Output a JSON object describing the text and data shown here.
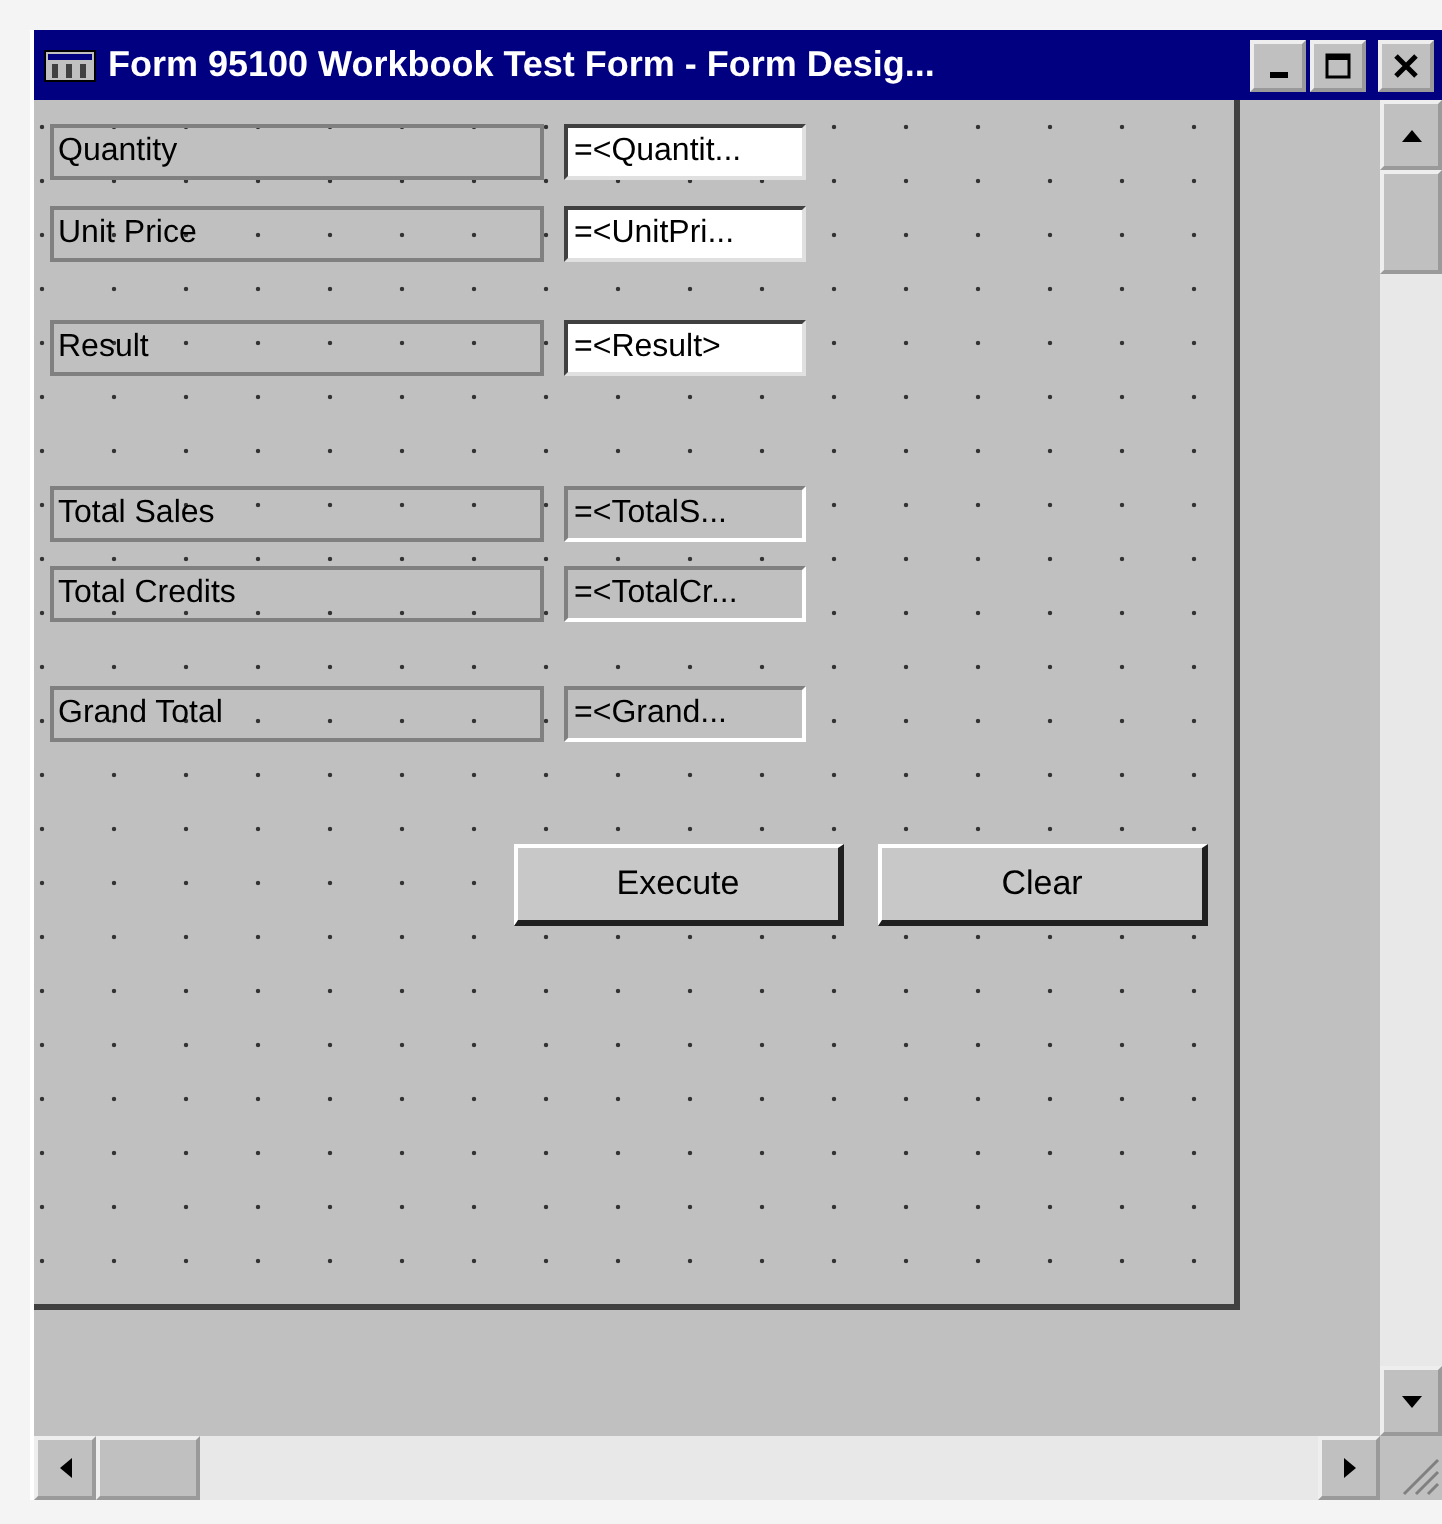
{
  "window": {
    "title": "Form 95100 Workbook Test Form - Form Desig..."
  },
  "rows": [
    {
      "label": "Quantity",
      "field": {
        "kind": "input",
        "value": "=<Quantit..."
      }
    },
    {
      "label": "Unit Price",
      "field": {
        "kind": "input",
        "value": "=<UnitPri..."
      }
    },
    {
      "label": "Result",
      "field": {
        "kind": "input",
        "value": "=<Result>"
      }
    },
    {
      "label": "Total Sales",
      "field": {
        "kind": "calculated",
        "value": "=<TotalS..."
      }
    },
    {
      "label": "Total Credits",
      "field": {
        "kind": "calculated",
        "value": "=<TotalCr..."
      }
    },
    {
      "label": "Grand Total",
      "field": {
        "kind": "calculated",
        "value": "=<Grand..."
      }
    }
  ],
  "buttons": [
    "Execute",
    "Clear"
  ]
}
